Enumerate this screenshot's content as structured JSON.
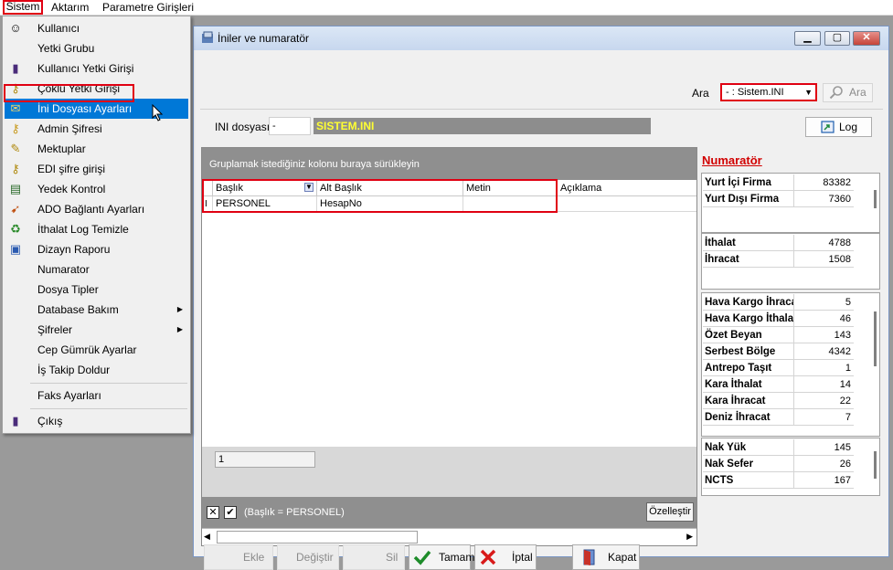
{
  "menubar": {
    "items": [
      "Sistem",
      "Aktarım",
      "Parametre Girişleri"
    ]
  },
  "menu": {
    "items": [
      {
        "label": "Kullanıcı",
        "icon": "user-icon"
      },
      {
        "label": "Yetki Grubu",
        "icon": ""
      },
      {
        "label": "Kullanıcı Yetki Girişi",
        "icon": "lock-icon"
      },
      {
        "label": "Çoklu Yetki Girişi",
        "icon": "keys-icon"
      },
      {
        "label": "İni Dosyası  Ayarları",
        "icon": "settings-file-icon"
      },
      {
        "label": "Admin Şifresi",
        "icon": "key-icon"
      },
      {
        "label": "Mektuplar",
        "icon": "letter-icon"
      },
      {
        "label": "EDI şifre girişi",
        "icon": "keys-icon"
      },
      {
        "label": "Yedek Kontrol",
        "icon": "backup-icon"
      },
      {
        "label": "ADO Bağlantı Ayarları",
        "icon": "connection-icon"
      },
      {
        "label": "İthalat Log Temizle",
        "icon": "clean-icon"
      },
      {
        "label": "Dizayn Raporu",
        "icon": "report-icon"
      },
      {
        "label": "Numarator",
        "icon": ""
      },
      {
        "label": "Dosya Tipler",
        "icon": ""
      },
      {
        "label": "Database Bakım",
        "icon": "",
        "submenu": true
      },
      {
        "label": "Şifreler",
        "icon": "",
        "submenu": true
      },
      {
        "label": "Cep Gümrük Ayarlar",
        "icon": ""
      },
      {
        "label": "İş Takip Doldur",
        "icon": ""
      },
      {
        "label": "Faks Ayarları",
        "icon": ""
      },
      {
        "label": "Çıkış",
        "icon": "exit-icon"
      }
    ],
    "highlighted": "İni Dosyası  Ayarları"
  },
  "window": {
    "title": "İniler ve numaratör"
  },
  "search": {
    "label": "Ara",
    "value": "- : Sistem.INI",
    "button": "Ara"
  },
  "ini": {
    "label": "INI dosyası",
    "field": "-",
    "value": "SISTEM.INI"
  },
  "log_button": "Log",
  "grid": {
    "group_hint": "Gruplamak istediğiniz kolonu buraya sürükleyin",
    "columns": [
      "Başlık",
      "Alt Başlık",
      "Metin",
      "Açıklama"
    ],
    "rows": [
      {
        "indicator": "I",
        "cells": [
          "PERSONEL",
          "HesapNo",
          "",
          ""
        ]
      }
    ],
    "footer_value": "1",
    "filter_text": "(Başlık = PERSONEL)",
    "customize_button": "Özelleştir"
  },
  "numarator": {
    "title": "Numaratör",
    "groups": [
      [
        {
          "name": "Yurt İçi Firma",
          "value": "83382"
        },
        {
          "name": "Yurt Dışı Firma",
          "value": "7360"
        }
      ],
      [
        {
          "name": "İthalat",
          "value": "4788"
        },
        {
          "name": "İhracat",
          "value": "1508"
        }
      ],
      [
        {
          "name": "Hava Kargo İhracat",
          "value": "5"
        },
        {
          "name": "Hava Kargo İthalat",
          "value": "46"
        },
        {
          "name": "Özet Beyan",
          "value": "143"
        },
        {
          "name": "Serbest Bölge",
          "value": "4342"
        },
        {
          "name": "Antrepo Taşıt",
          "value": "1"
        },
        {
          "name": "Kara İthalat",
          "value": "14"
        },
        {
          "name": "Kara İhracat",
          "value": "22"
        },
        {
          "name": "Deniz İhracat",
          "value": "7"
        }
      ],
      [
        {
          "name": "Nak Yük",
          "value": "145"
        },
        {
          "name": "Nak Sefer",
          "value": "26"
        },
        {
          "name": "NCTS",
          "value": "167"
        }
      ]
    ]
  },
  "buttons": {
    "ekle": "Ekle",
    "degistir": "Değiştir",
    "sil": "Sil",
    "tamam": "Tamam",
    "iptal": "İptal",
    "kapat": "Kapat"
  },
  "colors": {
    "highlight": "#0078d7",
    "annotation_red": "#e00012",
    "numarator_title": "#d10000",
    "ini_value_text": "#ffff33"
  }
}
